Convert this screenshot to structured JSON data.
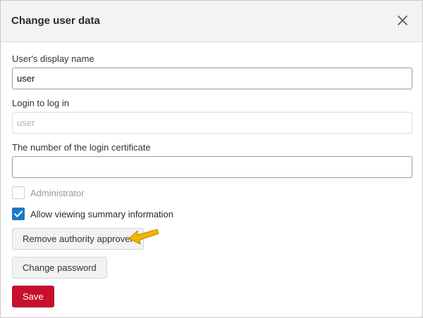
{
  "dialog": {
    "title": "Change user data"
  },
  "form": {
    "display_name": {
      "label": "User's display name",
      "value": "user"
    },
    "login": {
      "label": "Login to log in",
      "placeholder": "user"
    },
    "certificate": {
      "label": "The number of the login certificate",
      "value": ""
    },
    "administrator": {
      "label": "Administrator",
      "checked": false,
      "disabled": true
    },
    "allow_summary": {
      "label": "Allow viewing summary information",
      "checked": true
    }
  },
  "buttons": {
    "remove_approver": "Remove authority approver",
    "change_password": "Change password",
    "save": "Save"
  },
  "colors": {
    "accent_blue": "#1f78c8",
    "save_red": "#c8102e",
    "arrow_yellow": "#f4b400"
  },
  "icons": {
    "close": "close-icon",
    "checkmark": "checkmark-icon",
    "pointer_arrow": "pointer-arrow-icon"
  }
}
